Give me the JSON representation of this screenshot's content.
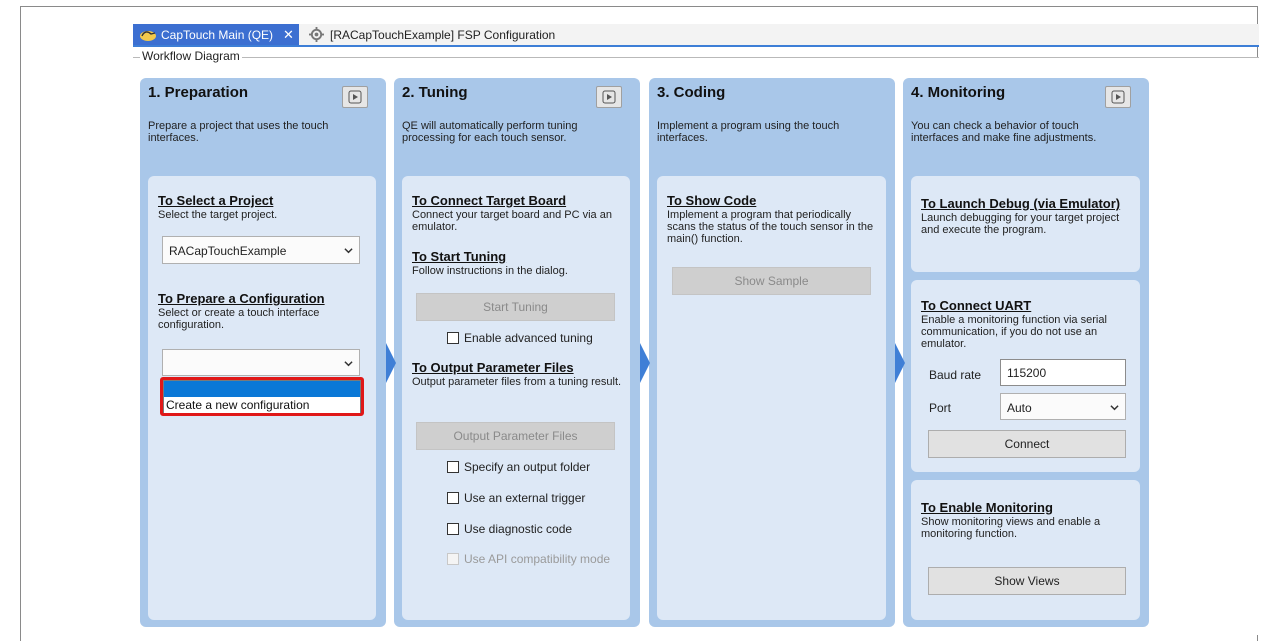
{
  "tabs": {
    "active_label": "CapTouch Main (QE)",
    "close_glyph": "✕",
    "inactive_label": "[RACapTouchExample] FSP Configuration"
  },
  "workflow_label": "Workflow Diagram",
  "columns": [
    {
      "title": "1. Preparation",
      "description": "Prepare a project that uses the touch interfaces.",
      "sections": [
        {
          "title": "To Select a Project",
          "desc": "Select the target project."
        },
        {
          "title": "To Prepare a Configuration",
          "desc": "Select or create a touch interface configuration."
        }
      ],
      "project_combo_value": "RACapTouchExample",
      "config_combo_value": "",
      "config_options": [
        "",
        "Create a new configuration"
      ]
    },
    {
      "title": "2. Tuning",
      "description": "QE will automatically perform tuning processing for each touch sensor.",
      "sections": [
        {
          "title": "To Connect Target Board",
          "desc": "Connect your target board and PC via an emulator."
        },
        {
          "title": "To Start Tuning",
          "desc": "Follow instructions in the dialog."
        },
        {
          "title": "To Output Parameter Files",
          "desc": "Output parameter files from a tuning result."
        }
      ],
      "start_tuning_label": "Start Tuning",
      "enable_advanced_label": "Enable advanced tuning",
      "output_files_label": "Output Parameter Files",
      "checkboxes": [
        "Specify an output folder",
        "Use an external trigger",
        "Use diagnostic code",
        "Use API compatibility mode"
      ]
    },
    {
      "title": "3. Coding",
      "description": "Implement a program using the touch interfaces.",
      "sections": [
        {
          "title": "To Show Code",
          "desc": "Implement a program that periodically scans the status of the touch sensor in the main() function."
        }
      ],
      "show_sample_label": "Show Sample"
    },
    {
      "title": "4. Monitoring",
      "description": "You can check a behavior of touch interfaces and make fine adjustments.",
      "sections": [
        {
          "title": "To Launch Debug (via Emulator)",
          "desc": "Launch debugging for your target project and execute the program."
        },
        {
          "title": "To Connect UART",
          "desc": "Enable a monitoring function via serial communication, if you do not use an emulator."
        },
        {
          "title": "To Enable Monitoring",
          "desc": "Show monitoring views and enable a monitoring function."
        }
      ],
      "baud_rate_label": "Baud rate",
      "baud_rate_value": "115200",
      "port_label": "Port",
      "port_value": "Auto",
      "connect_label": "Connect",
      "show_views_label": "Show Views"
    }
  ],
  "colors": {
    "column_bg": "#a9c7e9",
    "panel_bg": "#dde8f6",
    "accent": "#3c6fd1",
    "highlight": "#e01818",
    "selection": "#0a78d7"
  }
}
